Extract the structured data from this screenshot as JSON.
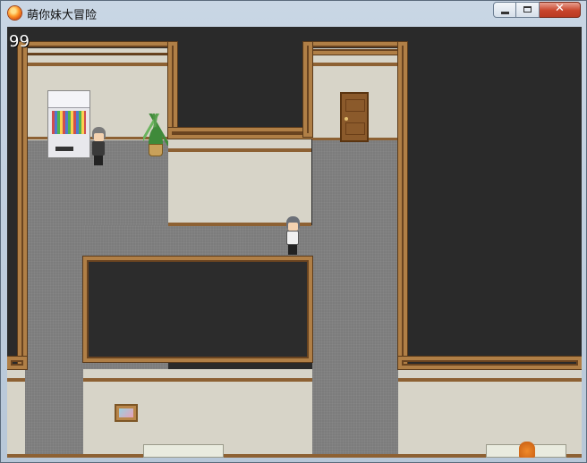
{
  "window": {
    "title": "萌你妹大冒险",
    "close_glyph": "✕"
  },
  "hud": {
    "score": "99"
  },
  "colors": {
    "floor": "#7c7c7c",
    "wall": "#d7d4c8",
    "wood_trim": "#b07f46",
    "void": "#2c2c2c"
  },
  "icons": {
    "app": "orange-orb-icon",
    "minimize": "minimize-icon",
    "maximize": "maximize-icon",
    "close": "close-icon"
  }
}
